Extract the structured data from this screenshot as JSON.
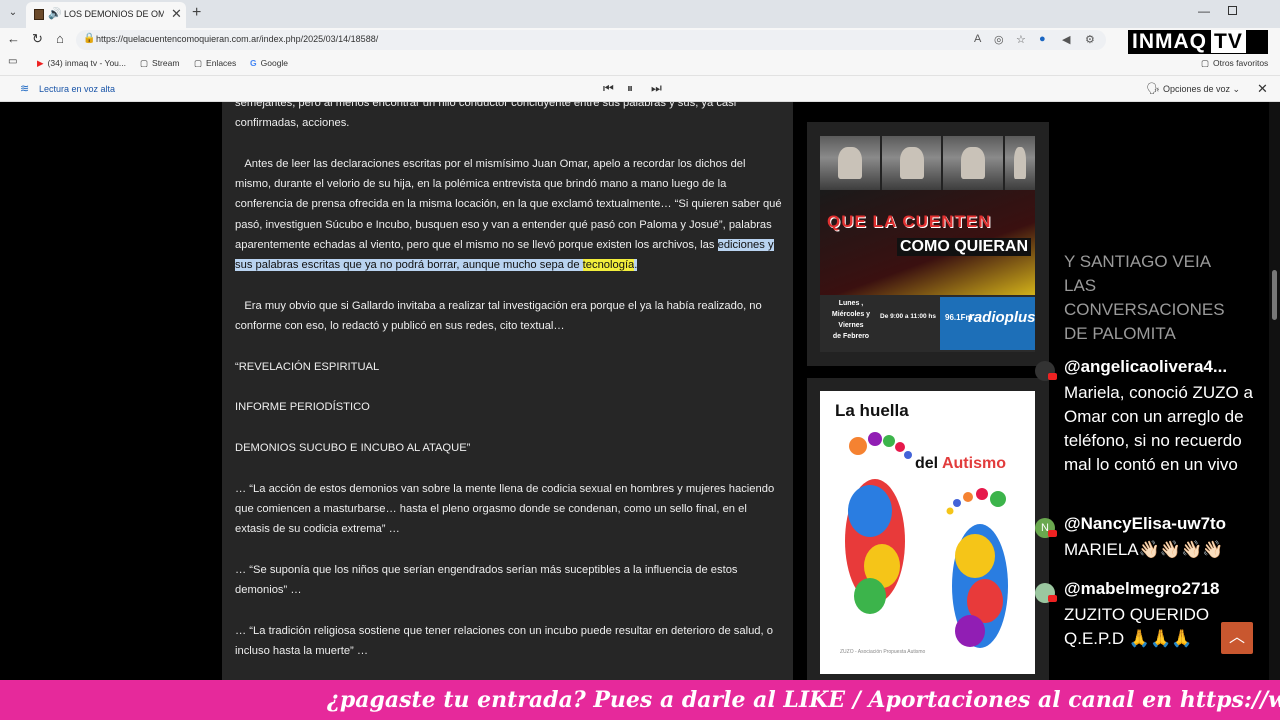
{
  "browser": {
    "tab_title": "LOS DEMONIOS DE OMAR GALLARDO",
    "url": "https://quelacuentencomoquieran.com.ar/index.php/2025/03/14/18588/",
    "bookmarks": [
      "(34) inmaq tv - You...",
      "Stream",
      "Enlaces",
      "Google"
    ],
    "other_bookmarks": "Otros favoritos"
  },
  "reader": {
    "label": "Lectura en voz alta",
    "voice_options": "Opciones de voz"
  },
  "article": {
    "p0": "semejantes, pero al menos encontrar un hilo conductor concluyente entre sus palabras y sus, ya casi confirmadas, acciones.",
    "p1_plain": "Antes de leer las declaraciones escritas por el mismísimo Juan Omar, apelo a recordar los dichos del mismo, durante el velorio de su hija, en la polémica entrevista que brindó mano a mano luego de la conferencia de prensa ofrecida en la misma locación, en la que exclamó textualmente… “Si quieren saber qué pasó, investiguen Súcubo e Incubo, busquen eso y van a entender qué pasó con Paloma y Josué”, palabras aparentemente echadas al viento, pero que el mismo no se llevó porque existen los archivos, las ",
    "p1_highlight": "ediciones y sus palabras escritas que ya no podrá borrar, aunque mucho sepa de ",
    "p1_word": "tecnología",
    "p1_end": ".",
    "p2": "Era muy obvio que si Gallardo invitaba a realizar tal investigación era porque el ya la había realizado, no conforme con eso, lo redactó y publicó en sus redes, cito textual…",
    "p3": "“REVELACIÓN ESPIRITUAL",
    "p4": "INFORME PERIODÍSTICO",
    "p5": "DEMONIOS SUCUBO E INCUBO AL ATAQUE”",
    "p6": "… “La acción de estos demonios van sobre la mente llena de codicia sexual en hombres y mujeres haciendo que comiencen a masturbarse… hasta el pleno orgasmo donde se condenan, como un sello final, en el extasis de su codicia extrema” …",
    "p7": "… “Se suponía que los niños que serían engendrados serían más suceptibles a la influencia de estos demonios” …",
    "p8": "… “La tradición religiosa sostiene que tener relaciones con un incubo puede resultar en deterioro de salud, o incluso hasta la muerte” …"
  },
  "sidebar": {
    "ad1_title1": "QUE LA CUENTEN",
    "ad1_title2": "COMO QUIERAN",
    "ad1_days": "Lunes ,\nMiércoles y\nViernes\nde Febrero",
    "ad1_time": "De 9:00 a 11:00 hs",
    "ad1_freq": "96.1Fm",
    "ad1_brand": "radioplus",
    "ad2_l1": "La huella",
    "ad2_l2a": "del ",
    "ad2_l2b": "Autismo",
    "ad2_foot": "ZUZO - Asociación Propuesta Autismo"
  },
  "overlay": {
    "logo": "INMAQ",
    "logo_tv": "TV",
    "chat_fade": "Y SANTIAGO VEIA\nLAS\nCONVERSACIONES\nDE PALOMITA",
    "messages": [
      {
        "user": "@angelicaolivera4...",
        "text": "Mariela, conoció ZUZO a Omar con un arreglo de teléfono, si no recuerdo mal lo contó en un vivo"
      },
      {
        "user": "@NancyElisa-uw7to",
        "text": "MARIELA👋🏻👋🏻👋🏻👋🏻"
      },
      {
        "user": "@mabelmegro2718",
        "text": "ZUZITO QUERIDO Q.E.P.D 🙏🙏🙏"
      }
    ],
    "ticker": "¿pagaste tu entrada? Pues a darle al LIKE / Aportaciones al canal en https://www.pa"
  },
  "colors": {
    "ticker_bg": "#e6299b",
    "highlight_blue": "#b9d3f0",
    "highlight_yellow": "#f2ee3c",
    "scroll_top_btn": "#c9572f"
  }
}
